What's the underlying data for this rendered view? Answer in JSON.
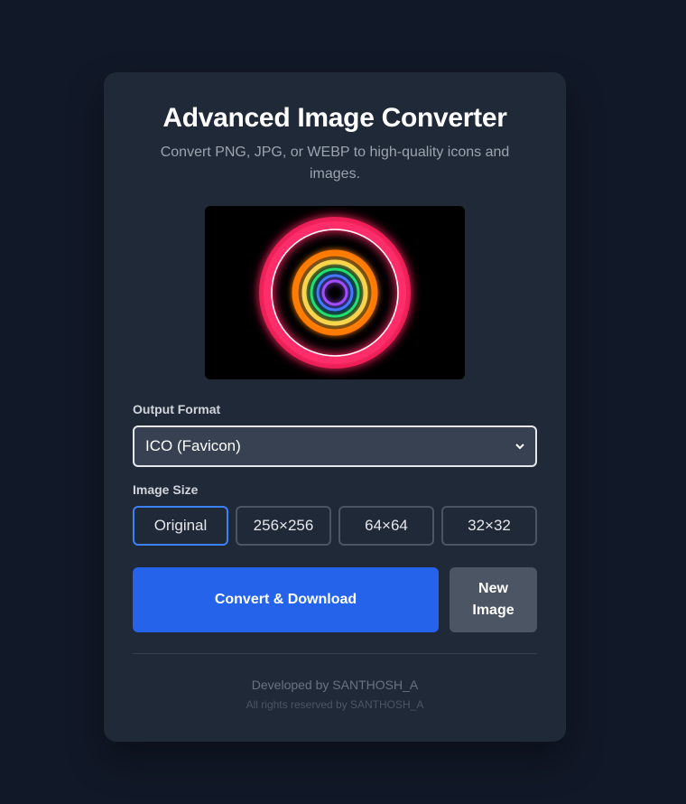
{
  "app": {
    "title": "Advanced Image Converter",
    "subtitle": "Convert PNG, JPG, or WEBP to high-quality icons and images."
  },
  "preview": {
    "alt_icon": "neon-rings-image"
  },
  "output_format": {
    "label": "Output Format",
    "selected": "ICO (Favicon)",
    "chevron_icon": "chevron-down-icon"
  },
  "image_size": {
    "label": "Image Size",
    "options": [
      "Original",
      "256×256",
      "64×64",
      "32×32"
    ],
    "selected": "Original"
  },
  "actions": {
    "convert_label": "Convert & Download",
    "new_label": "New Image"
  },
  "footer": {
    "developed_by": "Developed by SANTHOSH_A",
    "rights": "All rights reserved by SANTHOSH_A"
  },
  "colors": {
    "page_bg": "#111827",
    "card_bg": "#1f2937",
    "accent": "#2563eb",
    "active_border": "#3b82f6",
    "secondary_button": "#4b5563"
  }
}
